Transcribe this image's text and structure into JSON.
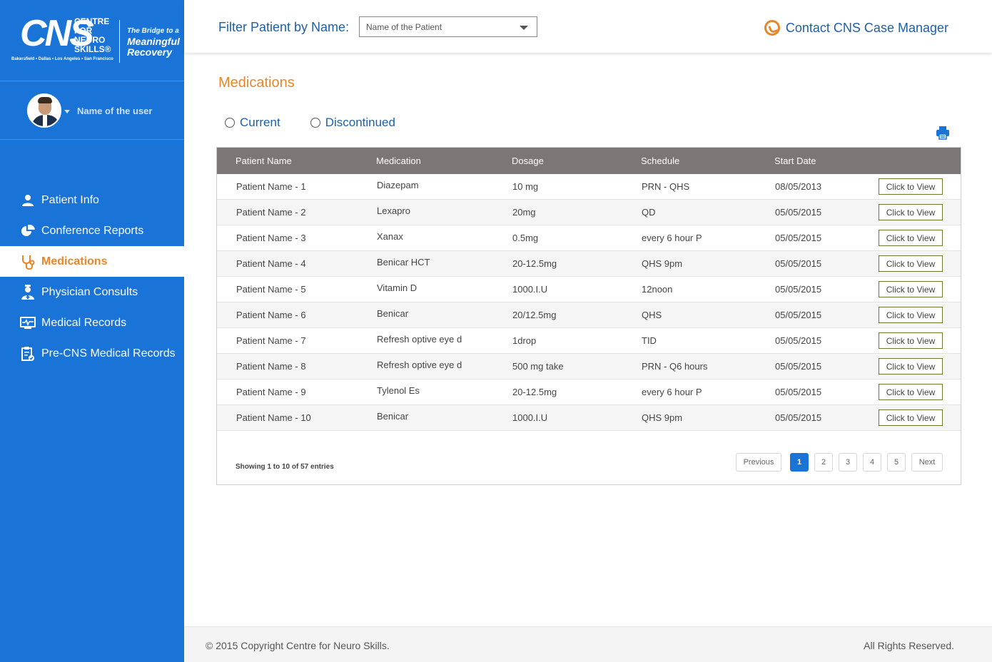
{
  "brand": {
    "logo_main": "CNS",
    "logo_sub": "CENTRE FOR NEURO SKILLS®",
    "cities": "Bakersfield • Dallas • Los Angeles • San Francisco",
    "tagline_top": "The Bridge to a",
    "tagline": "Meaningful Recovery"
  },
  "user": {
    "name": "Name of the user"
  },
  "nav": [
    {
      "label": "Patient Info",
      "icon": "person-icon",
      "active": false
    },
    {
      "label": "Conference Reports",
      "icon": "pie-chart-icon",
      "active": false
    },
    {
      "label": "Medications",
      "icon": "stethoscope-icon",
      "active": true
    },
    {
      "label": "Physician Consults",
      "icon": "doctor-icon",
      "active": false
    },
    {
      "label": "Medical Records",
      "icon": "monitor-icon",
      "active": false
    },
    {
      "label": "Pre-CNS Medical Records",
      "icon": "clipboard-icon",
      "active": false
    }
  ],
  "header": {
    "filter_label": "Filter Patient by Name:",
    "filter_placeholder": "Name of the Patient",
    "contact": "Contact CNS Case Manager"
  },
  "page": {
    "title": "Medications",
    "radios": [
      "Current",
      "Discontinued"
    ]
  },
  "table": {
    "columns": [
      "Patient Name",
      "Medication",
      "Dosage",
      "Schedule",
      "Start Date"
    ],
    "action_label": "Click to View",
    "rows": [
      [
        "Patient Name - 1",
        "Diazepam",
        "10 mg",
        "PRN - QHS",
        "08/05/2013"
      ],
      [
        "Patient Name - 2",
        "Lexapro",
        "20mg",
        "QD",
        "05/05/2015"
      ],
      [
        "Patient Name - 3",
        "Xanax",
        "0.5mg",
        "every 6 hour P",
        "05/05/2015"
      ],
      [
        "Patient Name - 4",
        "Benicar HCT",
        "20-12.5mg",
        "QHS 9pm",
        "05/05/2015"
      ],
      [
        "Patient Name - 5",
        "Vitamin D",
        "1000.I.U",
        "12noon",
        "05/05/2015"
      ],
      [
        "Patient Name - 6",
        "Benicar",
        "20/12.5mg",
        "QHS",
        "05/05/2015"
      ],
      [
        "Patient Name - 7",
        "Refresh optive eye d",
        "1drop",
        "TID",
        "05/05/2015"
      ],
      [
        "Patient Name - 8",
        "Refresh optive eye d",
        "500 mg take",
        "PRN - Q6 hours",
        "05/05/2015"
      ],
      [
        "Patient Name - 9",
        "Tylenol Es",
        "20-12.5mg",
        "every 6 hour P",
        "05/05/2015"
      ],
      [
        "Patient Name - 10",
        "Benicar",
        "1000.I.U",
        "QHS 9pm",
        "05/05/2015"
      ]
    ],
    "info": "Showing 1 to 10 of 57 entries",
    "pager": {
      "prev": "Previous",
      "pages": [
        "1",
        "2",
        "3",
        "4",
        "5"
      ],
      "current": "1",
      "next": "Next"
    }
  },
  "footer": {
    "copyright": "© 2015 Copyright Centre for Neuro Skills.",
    "rights": "All Rights Reserved."
  },
  "colors": {
    "brand_blue": "#1a73d6",
    "accent_orange": "#e8872a",
    "link_blue": "#1e5fa8",
    "table_header": "#7c7777"
  }
}
